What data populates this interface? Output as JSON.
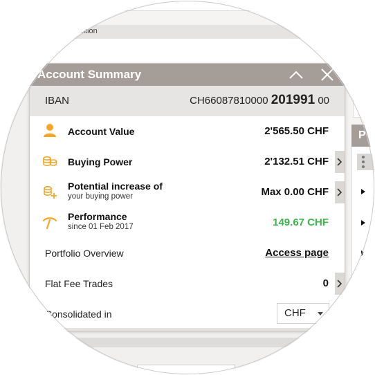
{
  "background": {
    "info_strip_text": "ormation",
    "right_panel_title": "P"
  },
  "widget": {
    "title": "Account Summary",
    "iban": {
      "label": "IBAN",
      "value_prefix": "CH66087810000",
      "value_bold": "201991",
      "value_suffix": "00"
    },
    "rows": [
      {
        "icon": "user-icon",
        "label": "Account Value",
        "value": "2'565.50 CHF"
      },
      {
        "icon": "coins-stack-icon",
        "label": "Buying Power",
        "value": "2'132.51 CHF"
      },
      {
        "icon": "coins-plus-icon",
        "label": "Potential increase of",
        "sublabel": "your buying power",
        "value": "Max 0.00 CHF"
      },
      {
        "icon": "performance-gauge-icon",
        "label": "Performance",
        "sublabel": "since 01 Feb 2017",
        "value": "149.67 CHF"
      }
    ],
    "portfolio": {
      "label": "Portfolio Overview",
      "link": "Access page"
    },
    "flat_fee": {
      "label": "Flat Fee Trades",
      "value": "0"
    },
    "consolidated": {
      "label": "Consolidated in",
      "selected": "CHF"
    }
  },
  "colors": {
    "header": "#a59d98",
    "accent_orange": "#f5a623",
    "positive_green": "#3ab54a"
  }
}
